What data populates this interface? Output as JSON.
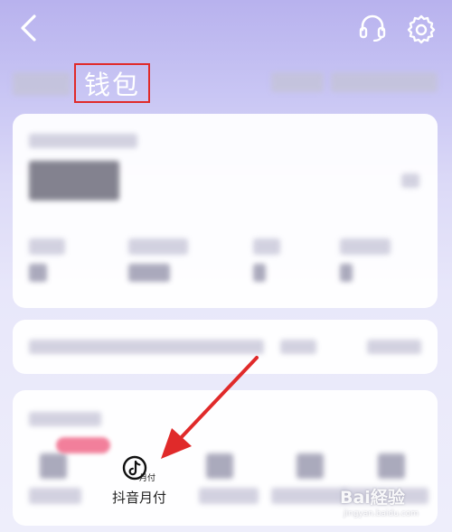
{
  "header": {
    "title": "钱包",
    "back_icon": "chevron-left-icon",
    "support_icon": "headset-icon",
    "settings_icon": "gear-icon"
  },
  "services": {
    "highlight_label": "抖音月付",
    "highlight_icon_text": "月付"
  },
  "watermark": {
    "brand": "Bai経验",
    "url": "jingyan.baidu.com"
  },
  "colors": {
    "annotation": "#e02a2a",
    "background_top": "#b8b2ee",
    "card": "#ffffff"
  }
}
